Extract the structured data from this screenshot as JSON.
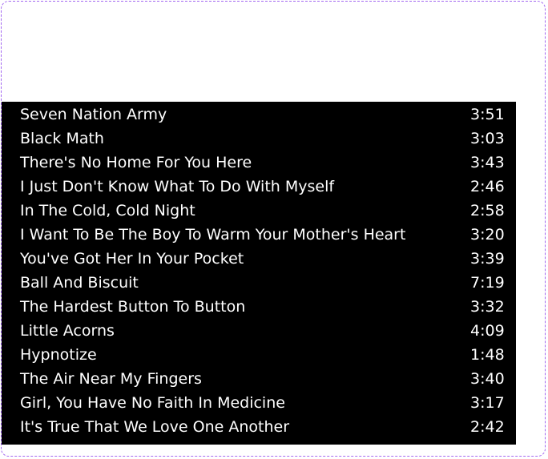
{
  "colors": {
    "frame_border": "#a368f0",
    "list_background": "#000000",
    "text": "#ffffff"
  },
  "tracks": [
    {
      "title": "Seven Nation Army",
      "duration": "3:51"
    },
    {
      "title": "Black Math",
      "duration": "3:03"
    },
    {
      "title": "There's No Home For You Here",
      "duration": "3:43"
    },
    {
      "title": "I Just Don't Know What To Do With Myself",
      "duration": "2:46"
    },
    {
      "title": "In The Cold, Cold Night",
      "duration": "2:58"
    },
    {
      "title": "I Want To Be The Boy To Warm Your Mother's Heart",
      "duration": "3:20"
    },
    {
      "title": "You've Got Her In Your Pocket",
      "duration": "3:39"
    },
    {
      "title": "Ball And Biscuit",
      "duration": "7:19"
    },
    {
      "title": "The Hardest Button To Button",
      "duration": "3:32"
    },
    {
      "title": "Little Acorns",
      "duration": "4:09"
    },
    {
      "title": "Hypnotize",
      "duration": "1:48"
    },
    {
      "title": "The Air Near My Fingers",
      "duration": "3:40"
    },
    {
      "title": "Girl, You Have No Faith In Medicine",
      "duration": "3:17"
    },
    {
      "title": "It's True That We Love One Another",
      "duration": "2:42"
    }
  ]
}
